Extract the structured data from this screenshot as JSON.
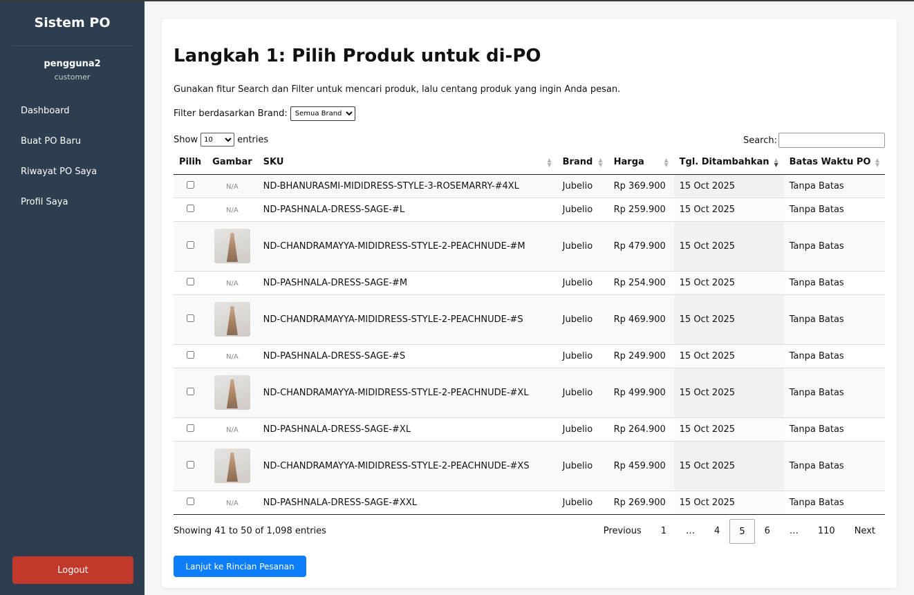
{
  "sidebar": {
    "brand": "Sistem PO",
    "user_name": "pengguna2",
    "user_role": "customer",
    "nav": [
      "Dashboard",
      "Buat PO Baru",
      "Riwayat PO Saya",
      "Profil Saya"
    ],
    "logout": "Logout"
  },
  "main": {
    "title": "Langkah 1: Pilih Produk untuk di-PO",
    "description": "Gunakan fitur Search dan Filter untuk mencari produk, lalu centang produk yang ingin Anda pesan.",
    "filter_label": "Filter berdasarkan Brand:",
    "filter_value": "Semua Brand",
    "show_label": "Show",
    "show_value": "10",
    "entries_label": "entries",
    "search_label": "Search:",
    "columns": [
      "Pilih",
      "Gambar",
      "SKU",
      "Brand",
      "Harga",
      "Tgl. Ditambahkan",
      "Batas Waktu PO"
    ],
    "rows": [
      {
        "image": "N/A",
        "sku": "ND-BHANURASMI-MIDIDRESS-STYLE-3-ROSEMARRY-#4XL",
        "brand": "Jubelio",
        "price": "Rp 369.900",
        "date": "15 Oct 2025",
        "deadline": "Tanpa Batas"
      },
      {
        "image": "N/A",
        "sku": "ND-PASHNALA-DRESS-SAGE-#L",
        "brand": "Jubelio",
        "price": "Rp 259.900",
        "date": "15 Oct 2025",
        "deadline": "Tanpa Batas"
      },
      {
        "image": "photo",
        "sku": "ND-CHANDRAMAYYA-MIDIDRESS-STYLE-2-PEACHNUDE-#M",
        "brand": "Jubelio",
        "price": "Rp 479.900",
        "date": "15 Oct 2025",
        "deadline": "Tanpa Batas"
      },
      {
        "image": "N/A",
        "sku": "ND-PASHNALA-DRESS-SAGE-#M",
        "brand": "Jubelio",
        "price": "Rp 254.900",
        "date": "15 Oct 2025",
        "deadline": "Tanpa Batas"
      },
      {
        "image": "photo",
        "sku": "ND-CHANDRAMAYYA-MIDIDRESS-STYLE-2-PEACHNUDE-#S",
        "brand": "Jubelio",
        "price": "Rp 469.900",
        "date": "15 Oct 2025",
        "deadline": "Tanpa Batas"
      },
      {
        "image": "N/A",
        "sku": "ND-PASHNALA-DRESS-SAGE-#S",
        "brand": "Jubelio",
        "price": "Rp 249.900",
        "date": "15 Oct 2025",
        "deadline": "Tanpa Batas"
      },
      {
        "image": "photo",
        "sku": "ND-CHANDRAMAYYA-MIDIDRESS-STYLE-2-PEACHNUDE-#XL",
        "brand": "Jubelio",
        "price": "Rp 499.900",
        "date": "15 Oct 2025",
        "deadline": "Tanpa Batas"
      },
      {
        "image": "N/A",
        "sku": "ND-PASHNALA-DRESS-SAGE-#XL",
        "brand": "Jubelio",
        "price": "Rp 264.900",
        "date": "15 Oct 2025",
        "deadline": "Tanpa Batas"
      },
      {
        "image": "photo",
        "sku": "ND-CHANDRAMAYYA-MIDIDRESS-STYLE-2-PEACHNUDE-#XS",
        "brand": "Jubelio",
        "price": "Rp 459.900",
        "date": "15 Oct 2025",
        "deadline": "Tanpa Batas"
      },
      {
        "image": "N/A",
        "sku": "ND-PASHNALA-DRESS-SAGE-#XXL",
        "brand": "Jubelio",
        "price": "Rp 269.900",
        "date": "15 Oct 2025",
        "deadline": "Tanpa Batas"
      }
    ],
    "info": "Showing 41 to 50 of 1,098 entries",
    "pagination": [
      "Previous",
      "1",
      "…",
      "4",
      "5",
      "6",
      "…",
      "110",
      "Next"
    ],
    "current_page": "5",
    "cta": "Lanjut ke Rincian Pesanan"
  },
  "colors": {
    "sidebar_bg": "#2c3e50",
    "logout_bg": "#c0392b",
    "primary": "#0d7ef7"
  }
}
